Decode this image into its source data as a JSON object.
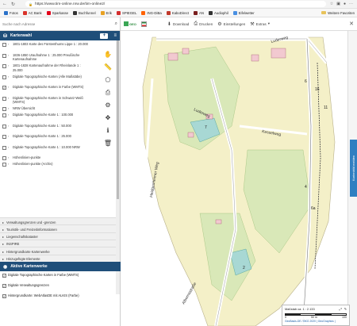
{
  "browser": {
    "url": "https://www.tim-online.nrw.de/tim-online2/",
    "bookmarks": [
      {
        "label": "Fotos",
        "color": "#2b72c9"
      },
      {
        "label": "AC Bank",
        "color": "#d9342b"
      },
      {
        "label": "Sparkasse",
        "color": "#e2001a"
      },
      {
        "label": "Buchfunnel",
        "color": "#333333"
      },
      {
        "label": "Erik",
        "color": "#e8a123"
      },
      {
        "label": "SPIEGEL",
        "color": "#d32f2f"
      },
      {
        "label": "ING-DiBa",
        "color": "#ff6200"
      },
      {
        "label": "KaboDirect",
        "color": "#c0392b"
      },
      {
        "label": "AN",
        "color": "#7a1f1f"
      },
      {
        "label": "Audiophil",
        "color": "#333333"
      },
      {
        "label": "Eifelwetter",
        "color": "#4a90e2"
      }
    ],
    "other_favorites": "Weitere Favoriten"
  },
  "search": {
    "placeholder": "Suche nach Adresse"
  },
  "panel": {
    "title": "Kartenwahl"
  },
  "layers": [
    {
      "label": "1801-1803 Karte des Fürstenthums Lippe 1 : 20.000",
      "checked": false,
      "lines": 2
    },
    {
      "label": "1836-1850 Uraufnahme 1 : 25.000 Preußische Kartenaufnahme",
      "checked": false,
      "lines": 2
    },
    {
      "label": "1801-1828 Kartenaufnahme der Rheinlande 1 : 25.000",
      "checked": false,
      "lines": 2
    },
    {
      "label": "Digitale Topographische Karten (Alle Maßstäbe)",
      "checked": false,
      "lines": 2
    },
    {
      "label": "Digitale Topographische Karten in Farbe (WMTS)",
      "checked": true,
      "lines": 2
    },
    {
      "label": "Digitale Topographische Karten in Schwarz-Weiß (WMTS)",
      "checked": false,
      "lines": 2
    },
    {
      "label": "NRW Übersicht",
      "checked": false,
      "lines": 1
    },
    {
      "label": "Digitale Topographische Karte 1 : 100.000",
      "checked": false,
      "lines": 2
    },
    {
      "label": "Digitale Topographische Karte 1 : 50.000",
      "checked": false,
      "lines": 2
    },
    {
      "label": "Digitale Topographische Karte 1 : 25.000",
      "checked": false,
      "lines": 2
    },
    {
      "label": "Digitale Topographische Karte 1 : 10.000 NRW",
      "checked": false,
      "lines": 2
    },
    {
      "label": "Höhenlinien-punkte",
      "checked": false,
      "lines": 1
    },
    {
      "label": "Höhenlinien-punkte (Archiv)",
      "checked": false,
      "lines": 1
    }
  ],
  "categories": [
    "Verwaltungsgrenzen und -grenzen",
    "Touristik- und Freizeitinformationen",
    "Liegenschaftskataster",
    "INSPIRE",
    "Hintergrundkarte Kartenwerke",
    "Hinzugefügte Elemente"
  ],
  "active": {
    "title": "Aktive Kartenwerke",
    "items": [
      {
        "label": "Digitale Topographische Karten in Farbe (WMTS)",
        "checked": true
      },
      {
        "label": "Digitale Verwaltungsgrenzen",
        "checked": true
      },
      {
        "label": "Hintergrundkarte: WebAtlasDE mit ALKIS (Farbe)",
        "checked": true
      }
    ]
  },
  "tools": [
    "hand-icon",
    "ruler-icon",
    "area-measure-icon",
    "print-icon",
    "settings-tool-icon",
    "move-icon",
    "info-icon",
    "delete-icon"
  ],
  "map_toolbar": {
    "logo_text": "GEO",
    "download": "Download",
    "print": "Drucken",
    "settings": "Einstellungen",
    "extras": "Extras"
  },
  "map_labels": {
    "street1": "Luderweg",
    "street2": "Kesselweg",
    "street3": "Heidgesheimer Weg",
    "street4": "Luderweg",
    "street5": "Albernsstraße",
    "num1": "6",
    "num2": "16",
    "num3": "11",
    "num4": "4",
    "num5": "6a",
    "num6": "7",
    "num7": "2"
  },
  "side_tab": "Kartenbild melden",
  "scale": {
    "label": "Maßstab ca. 1 : 2.133",
    "tick0": "0",
    "tick1": "50 m",
    "tick2": "100",
    "attribution": "GeoBasis-DE / BKG 2020 | GeoGraphics |"
  },
  "colors": {
    "header": "#1f4e79",
    "map_bg": "#f4f0c8",
    "forest": "#cfe3b0",
    "building": "#f2c9d0",
    "road": "#ffffff",
    "water": "#a8d8d4"
  }
}
